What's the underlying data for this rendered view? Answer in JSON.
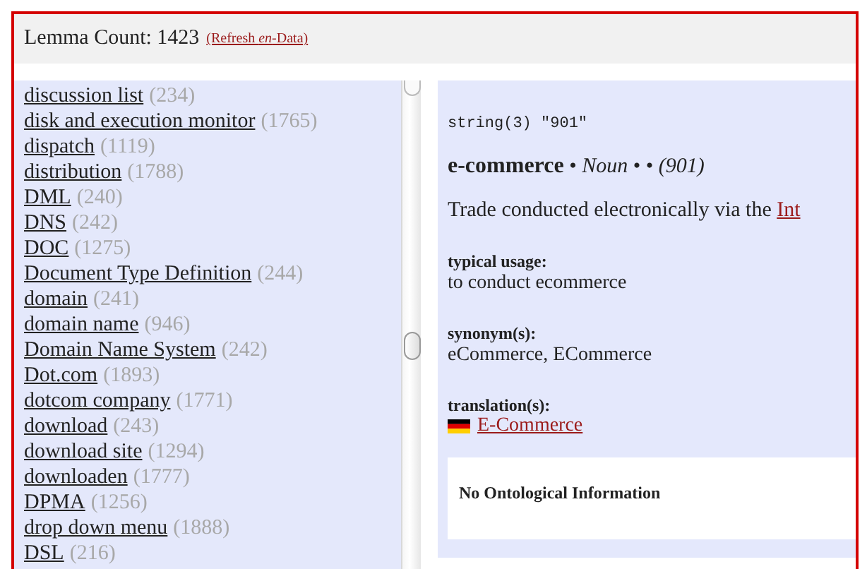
{
  "header": {
    "lemma_count": "Lemma Count: 1423",
    "refresh_prefix": "(Refresh ",
    "refresh_lang": "en",
    "refresh_suffix": "-Data)"
  },
  "lemmas": [
    {
      "term": "discussion list",
      "count": "(234)"
    },
    {
      "term": "disk and execution monitor",
      "count": "(1765)"
    },
    {
      "term": "dispatch",
      "count": "(1119)"
    },
    {
      "term": "distribution",
      "count": "(1788)"
    },
    {
      "term": "DML",
      "count": "(240)"
    },
    {
      "term": "DNS",
      "count": "(242)"
    },
    {
      "term": "DOC",
      "count": "(1275)"
    },
    {
      "term": "Document Type Definition",
      "count": "(244)"
    },
    {
      "term": "domain",
      "count": "(241)"
    },
    {
      "term": "domain name",
      "count": "(946)"
    },
    {
      "term": "Domain Name System",
      "count": "(242)"
    },
    {
      "term": "Dot.com",
      "count": "(1893)"
    },
    {
      "term": "dotcom company",
      "count": "(1771)"
    },
    {
      "term": "download",
      "count": "(243)"
    },
    {
      "term": "download site",
      "count": "(1294)"
    },
    {
      "term": "downloaden",
      "count": "(1777)"
    },
    {
      "term": "DPMA",
      "count": "(1256)"
    },
    {
      "term": "drop down menu",
      "count": "(1888)"
    },
    {
      "term": "DSL",
      "count": "(216)"
    }
  ],
  "entry": {
    "debug": "string(3) \"901\"",
    "headword": "e-commerce",
    "separator": "•",
    "pos": "Noun",
    "bullets": "• •",
    "id": "(901)",
    "definition": "Trade conducted electronically via the ",
    "definition_link": "Int",
    "sections": [
      {
        "kind": "text",
        "label": "typical usage:",
        "value": "to conduct ecommerce"
      },
      {
        "kind": "text",
        "label": "synonym(s):",
        "value": "eCommerce, ECommerce"
      },
      {
        "kind": "translation",
        "label": "translation(s):",
        "value": "E-Commerce"
      }
    ],
    "ontology": "No Ontological Information"
  }
}
